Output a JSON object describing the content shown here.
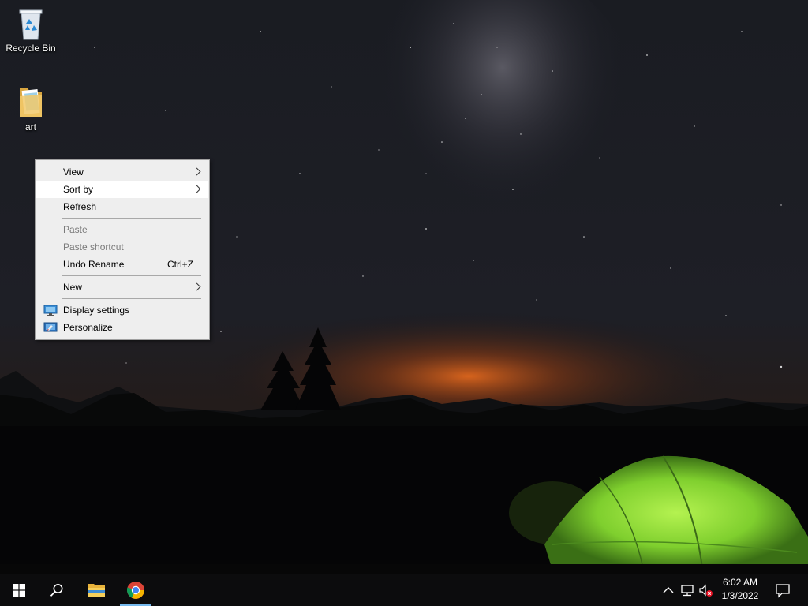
{
  "desktop": {
    "icons": [
      {
        "label": "Recycle Bin",
        "icon": "recycle-bin-icon"
      },
      {
        "label": "art",
        "icon": "folder-icon"
      }
    ]
  },
  "context_menu": {
    "items": [
      {
        "label": "View",
        "submenu": true,
        "enabled": true
      },
      {
        "label": "Sort by",
        "submenu": true,
        "enabled": true,
        "highlighted": true
      },
      {
        "label": "Refresh",
        "enabled": true
      },
      {
        "label": "Paste",
        "enabled": false
      },
      {
        "label": "Paste shortcut",
        "enabled": false
      },
      {
        "label": "Undo Rename",
        "shortcut": "Ctrl+Z",
        "enabled": true
      },
      {
        "label": "New",
        "submenu": true,
        "enabled": true
      },
      {
        "label": "Display settings",
        "icon": "display-settings-icon",
        "enabled": true
      },
      {
        "label": "Personalize",
        "icon": "personalize-icon",
        "enabled": true
      }
    ]
  },
  "taskbar": {
    "buttons": [
      {
        "name": "Start",
        "icon": "windows-logo-icon"
      },
      {
        "name": "Search",
        "icon": "search-icon"
      },
      {
        "name": "File Explorer",
        "icon": "file-explorer-icon"
      },
      {
        "name": "Google Chrome",
        "icon": "chrome-icon",
        "active": true
      }
    ],
    "tray": {
      "icons": [
        "chevron-up-icon",
        "network-icon",
        "volume-muted-icon"
      ],
      "time": "6:02 AM",
      "date": "1/3/2022",
      "notification_icon": "action-center-icon"
    }
  },
  "colors": {
    "accent": "#76b9ed",
    "menu_background": "#eeeeee",
    "taskbar_background": "#0c0c0d",
    "tent_green": "#8fe23a",
    "horizon_glow": "#d5621c"
  }
}
